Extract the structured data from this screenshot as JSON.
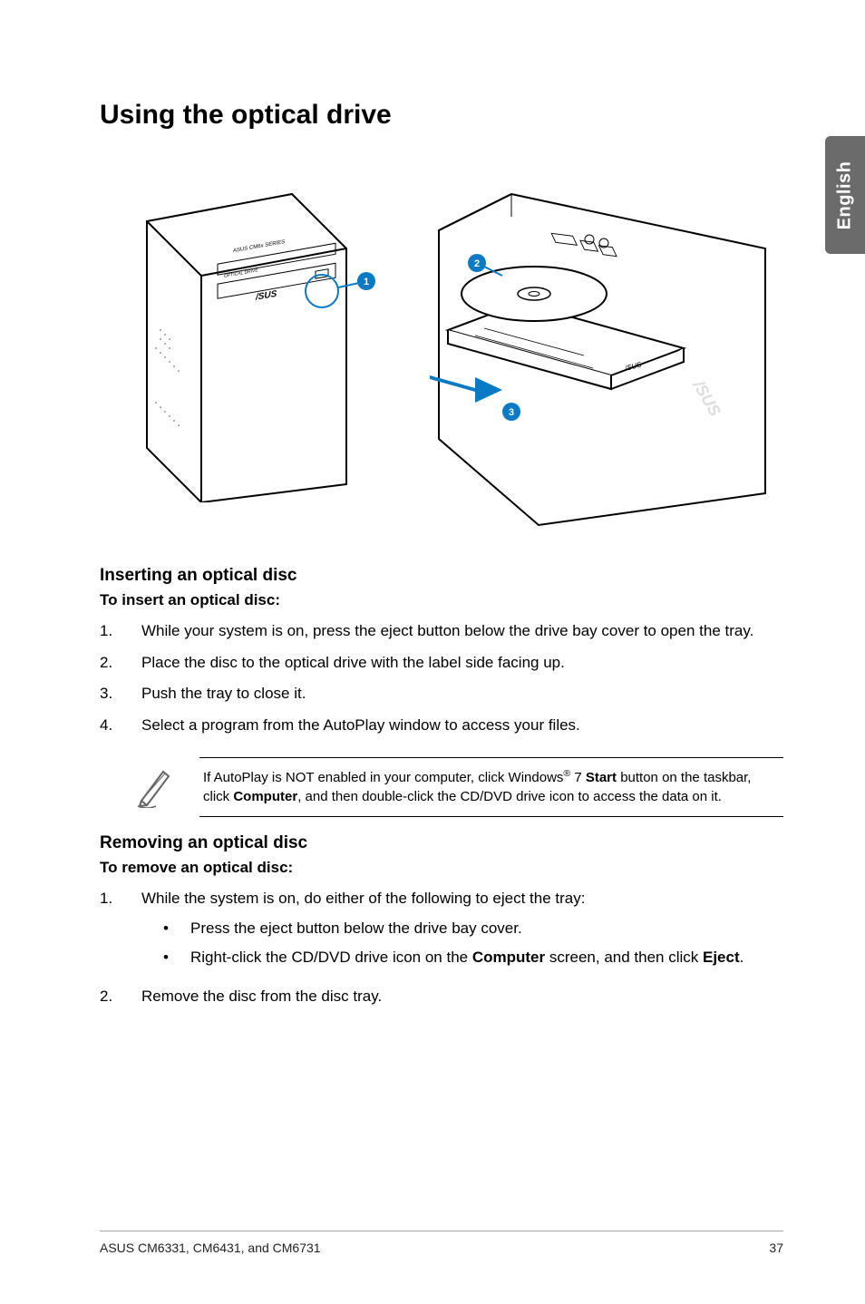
{
  "sideTab": "English",
  "header": {
    "title": "Using the optical drive"
  },
  "fig": {
    "callouts": {
      "c1": "1",
      "c2": "2",
      "c3": "3"
    }
  },
  "sectionInsert": {
    "heading": "Inserting an optical disc",
    "subhead": "To insert an optical disc:",
    "steps": [
      {
        "n": "1.",
        "t": "While your system is on, press the eject button below the drive bay cover to open the tray."
      },
      {
        "n": "2.",
        "t": "Place the disc to the optical drive with the label side facing up."
      },
      {
        "n": "3.",
        "t": "Push the tray to close it."
      },
      {
        "n": "4.",
        "t": "Select a program from the AutoPlay window to access your files."
      }
    ]
  },
  "note": {
    "pre": "If AutoPlay is NOT enabled in your computer, click Windows",
    "sup": "®",
    "mid1": " 7 ",
    "bold1": "Start",
    "mid2": " button on the taskbar, click ",
    "bold2": "Computer",
    "post": ", and then double-click the CD/DVD drive icon to access the data on it."
  },
  "sectionRemove": {
    "heading": "Removing an optical disc",
    "subhead": "To remove an optical disc:",
    "steps": [
      {
        "n": "1.",
        "t": "While the system is on, do either of the following to eject the tray:"
      },
      {
        "n": "2.",
        "t": "Remove the disc from the disc tray."
      }
    ],
    "sub": [
      {
        "t": "Press the eject button below the drive bay cover."
      },
      {
        "pre": "Right-click the CD/DVD drive icon on the ",
        "b1": "Computer",
        "mid": " screen, and then click ",
        "b2": "Eject",
        "post": "."
      }
    ]
  },
  "footer": {
    "left": "ASUS CM6331, CM6431, and CM6731",
    "right": "37"
  }
}
